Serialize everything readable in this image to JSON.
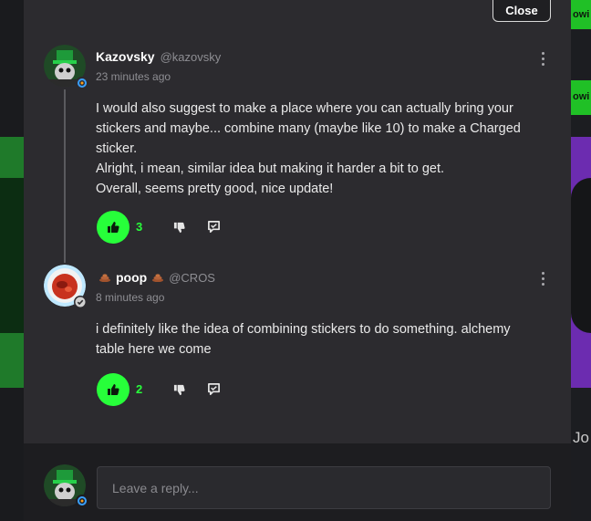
{
  "modal": {
    "close_label": "Close"
  },
  "background": {
    "pill_top": "owi",
    "pill_mid": "owi",
    "side_text": "Jo"
  },
  "comments": [
    {
      "author": "Kazovsky",
      "handle": "@kazovsky",
      "time": "23 minutes ago",
      "body": [
        "I would also suggest to make a place where you can actually bring your",
        "stickers and maybe... combine many (maybe like 10) to make a Charged",
        "sticker.",
        "Alright, i mean, similar idea but making it harder a bit to get.",
        "Overall, seems pretty good, nice update!"
      ],
      "likes": "3"
    },
    {
      "author": "poop",
      "handle": "@CROS",
      "time": "8 minutes ago",
      "body": [
        "i definitely like the idea of combining stickers to do something. alchemy",
        "table here we come"
      ],
      "likes": "2"
    }
  ],
  "reply": {
    "placeholder": "Leave a reply..."
  },
  "colors": {
    "accent": "#27ff3a",
    "panel": "#2c2b2f",
    "reply_bar": "#1d1d20"
  }
}
